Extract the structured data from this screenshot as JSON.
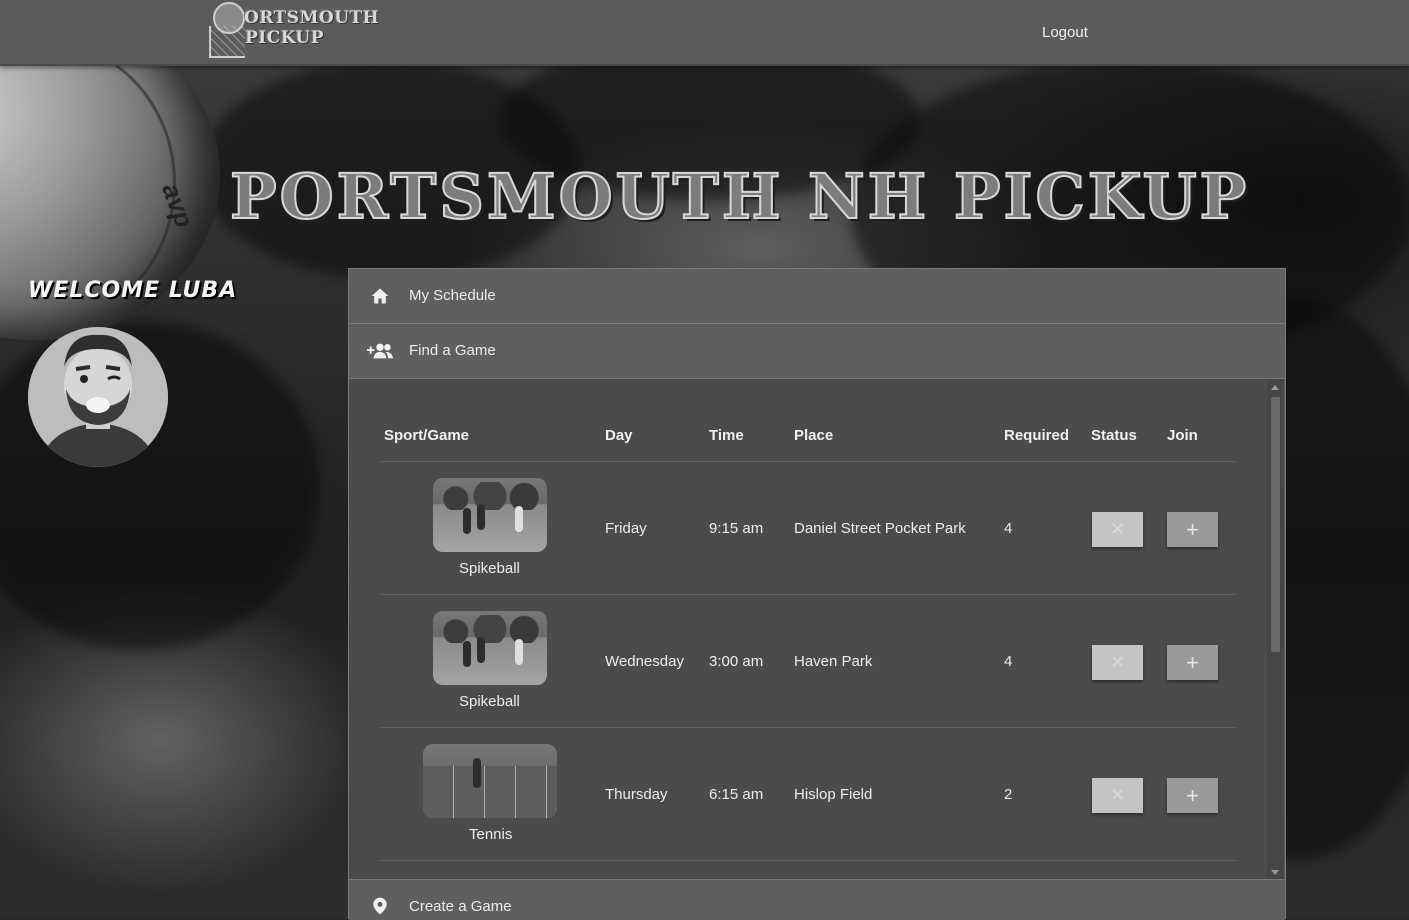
{
  "nav": {
    "logo_line1": "ORTSMOUTH",
    "logo_line2": "PICKUP",
    "logout_label": "Logout"
  },
  "hero": {
    "title": "PORTSMOUTH NH PICKUP"
  },
  "background": {
    "ball_text": "avp"
  },
  "user": {
    "welcome": "WELCOME LUBA"
  },
  "accordion": {
    "my_schedule": {
      "label": "My Schedule",
      "icon": "home-icon"
    },
    "find_game": {
      "label": "Find a Game",
      "icon": "group-add-icon"
    },
    "create_game": {
      "label": "Create a Game",
      "icon": "location-pin-icon"
    }
  },
  "table": {
    "headers": {
      "sport": "Sport/Game",
      "day": "Day",
      "time": "Time",
      "place": "Place",
      "required": "Required",
      "status": "Status",
      "join": "Join"
    },
    "rows": [
      {
        "sport": "Spikeball",
        "day": "Friday",
        "time": "9:15 am",
        "place": "Daniel Street Pocket Park",
        "required": "4",
        "status_icon": "x-icon",
        "join_label": "+"
      },
      {
        "sport": "Spikeball",
        "day": "Wednesday",
        "time": "3:00 am",
        "place": "Haven Park",
        "required": "4",
        "status_icon": "x-icon",
        "join_label": "+"
      },
      {
        "sport": "Tennis",
        "day": "Thursday",
        "time": "6:15 am",
        "place": "Hislop Field",
        "required": "2",
        "status_icon": "x-icon",
        "join_label": "+"
      }
    ]
  },
  "colors": {
    "topbar": "#5b5b5b",
    "panel": "#5e5e5e",
    "table_bg": "#4b4b4b",
    "button": "#c4c4c4",
    "join_button": "#9a9a9a"
  }
}
